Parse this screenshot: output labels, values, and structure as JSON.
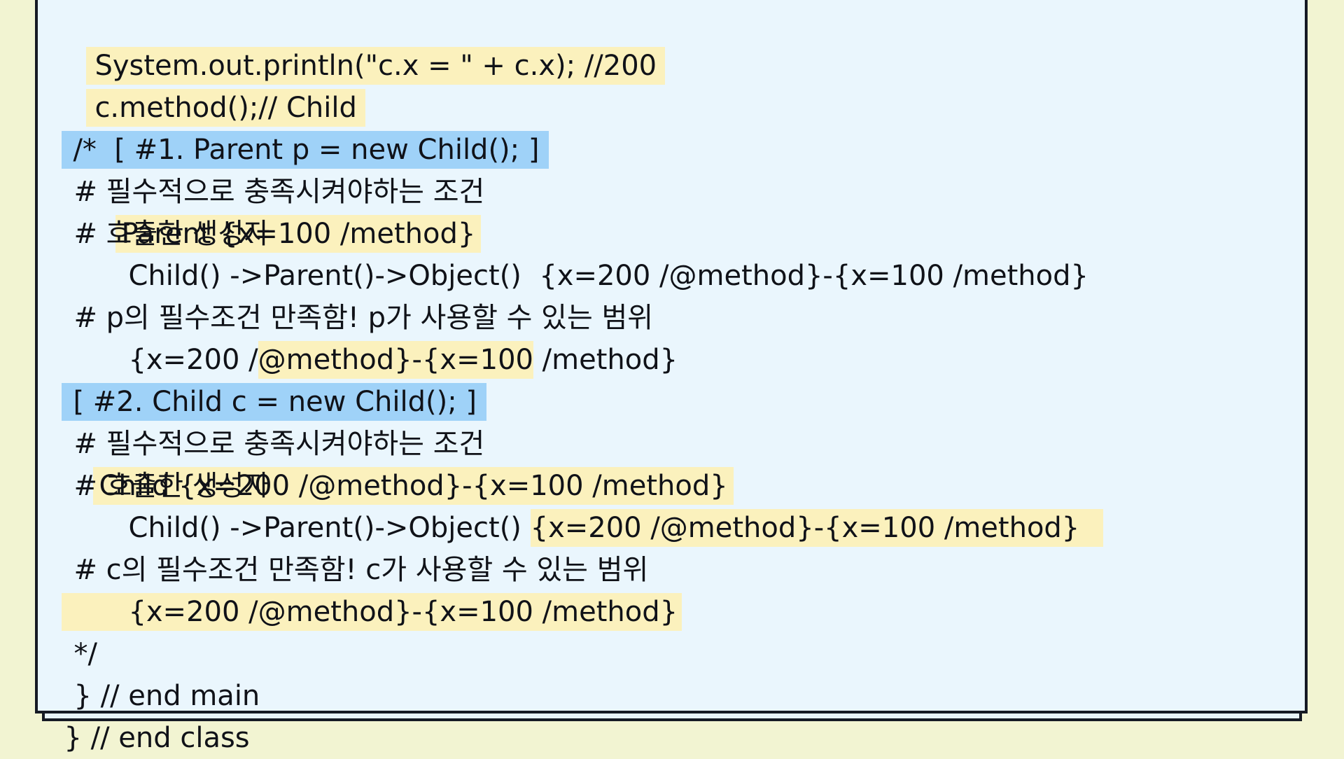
{
  "code": {
    "line1": "System.out.println(\"c.x = \" + c.x); //200",
    "line2": "c.method();// Child",
    "line3": "/*  [ #1. Parent p = new Child(); ]",
    "line4_text": "# 필수적으로 충족시켜야하는 조건",
    "line4_hl": "Parent {x=100 /method}",
    "line5": "# 호출한 생성자",
    "line6": "Child() ->Parent()->Object()  {x=200 /@method}-{x=100 /method}",
    "line7": "# p의 필수조건 만족함! p가 사용할 수 있는 범위",
    "line8_a": "{x=200 /",
    "line8_hl": "@method}-{x=100",
    "line8_b": " /method}",
    "line9": "[ #2. Child c = new Child(); ]",
    "line10_text": "# 필수적으로 충족시켜야하는 조건",
    "line10_hl": "Child {x=200 /@method}-{x=100 /method}",
    "line11": "# 호출한 생성자",
    "line12_a": "Child() ->Parent()->Object() ",
    "line12_hl": "{x=200 /@method}-{x=100 /method}",
    "line13": "# c의 필수조건 만족함! c가 사용할 수 있는 범위",
    "line14": "{x=200 /@method}-{x=100 /method}",
    "line15": "*/",
    "line16": "} // end main",
    "line17": "} // end class"
  },
  "colors": {
    "background": "#f2f4d2",
    "card": "#eaf6fd",
    "highlight_yellow": "#fbf1bd",
    "highlight_blue": "#9fd2f8",
    "text": "#101218",
    "border": "#161a24"
  }
}
